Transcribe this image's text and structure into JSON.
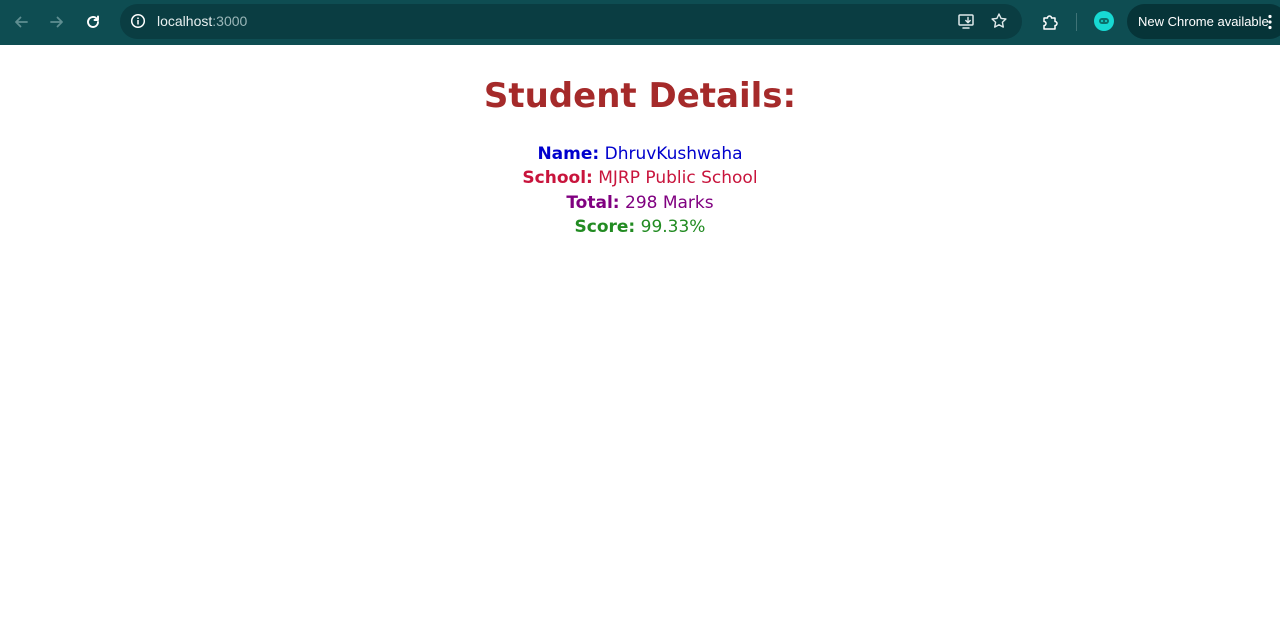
{
  "browser": {
    "url_host": "localhost",
    "url_port": ":3000",
    "update_label": "New Chrome available",
    "icons": {
      "back": "back-arrow-icon",
      "forward": "forward-arrow-icon",
      "reload": "reload-icon",
      "site_info": "info-icon",
      "install": "install-app-icon",
      "bookmark": "star-icon",
      "extensions": "puzzle-icon",
      "profile": "avatar",
      "menu": "kebab-menu-icon"
    },
    "colors": {
      "toolbar": "#0e4d52",
      "omnibox": "#0a3d42",
      "chip": "#063438"
    }
  },
  "page": {
    "title": "Student Details:",
    "rows": [
      {
        "label": "Name:",
        "value": "DhruvKushwaha",
        "color": "#0000cd"
      },
      {
        "label": "School:",
        "value": "MJRP Public School",
        "color": "#c8143c"
      },
      {
        "label": "Total:",
        "value": "298 Marks",
        "color": "#800080"
      },
      {
        "label": "Score:",
        "value": "99.33%",
        "color": "#228b22"
      }
    ],
    "title_color": "#a52a2a"
  }
}
